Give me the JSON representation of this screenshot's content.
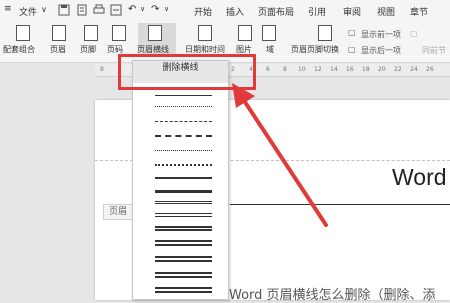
{
  "ribbon": {
    "tabs": [
      "文件",
      "开始",
      "插入",
      "页面布局",
      "引用",
      "审阅",
      "视图",
      "章节"
    ],
    "groups": [
      "配套组合",
      "页眉",
      "页脚",
      "页码",
      "页眉横线",
      "日期和时间",
      "图片",
      "域",
      "页眉页脚切换"
    ],
    "options": {
      "show_prev": "显示前一项",
      "show_next": "显示后一项",
      "same_as_prev": "同前节"
    }
  },
  "ruler": {
    "ticks": [
      "8",
      "2",
      "4",
      "6",
      "8",
      "10",
      "12",
      "14",
      "16",
      "18",
      "20",
      "22",
      "24",
      "26",
      "28",
      "30",
      "32",
      "34"
    ]
  },
  "dropdown": {
    "delete_label": "删除横线"
  },
  "document": {
    "header_tag": "页眉",
    "header_text": "Word",
    "body_text": "Word 页眉横线怎么删除（删除、添"
  },
  "colors": {
    "highlight": "#e23a3a",
    "arrow": "#e23a3a"
  }
}
